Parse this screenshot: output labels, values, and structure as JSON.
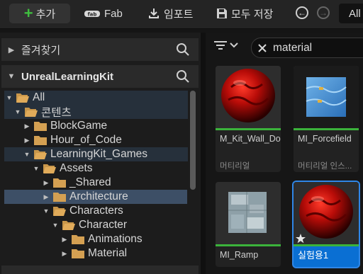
{
  "toolbar": {
    "add_label": "추가",
    "fab_label": "Fab",
    "import_label": "임포트",
    "save_label": "모두 저장",
    "path_label": "All"
  },
  "favorites": {
    "label": "즐겨찾기"
  },
  "project": {
    "label": "UnrealLearningKit"
  },
  "tree": [
    {
      "label": "All"
    },
    {
      "label": "콘텐츠"
    },
    {
      "label": "BlockGame"
    },
    {
      "label": "Hour_of_Code"
    },
    {
      "label": "LearningKit_Games"
    },
    {
      "label": "Assets"
    },
    {
      "label": "_Shared"
    },
    {
      "label": "Architecture"
    },
    {
      "label": "Characters"
    },
    {
      "label": "Character"
    },
    {
      "label": "Animations"
    },
    {
      "label": "Material"
    }
  ],
  "search": {
    "value": "material"
  },
  "assets": [
    {
      "name": "M_Kit_Wall_Door",
      "type": "머티리얼"
    },
    {
      "name": "MI_Forcefield",
      "type": "머티리얼 인스..."
    },
    {
      "name": "MI_Ramp",
      "type": ""
    },
    {
      "name": "실험용1",
      "type": ""
    }
  ],
  "colors": {
    "accent_selection": "#0a6fd3",
    "material_bar": "#3bb33b",
    "add_plus": "#3fbf3f"
  }
}
